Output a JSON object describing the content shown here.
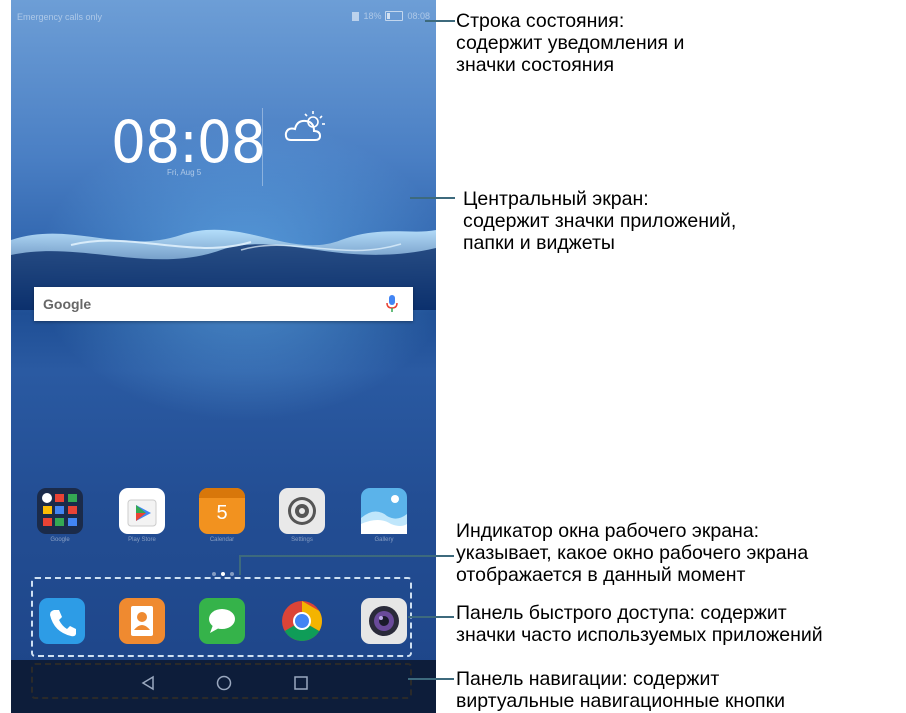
{
  "status_bar": {
    "carrier_text": "Emergency calls only",
    "battery_percent": "18%",
    "time": "08:08"
  },
  "clock_widget": {
    "time": "08:08",
    "date": "Fri, Aug 5",
    "weather_icon": "partly-cloudy-icon"
  },
  "search_bar": {
    "logo": "Google",
    "mic_icon": "microphone-icon"
  },
  "home_apps": [
    {
      "name": "Google",
      "icon": "folder-icon"
    },
    {
      "name": "Play Store",
      "icon": "play-store-icon"
    },
    {
      "name": "Calendar",
      "icon": "calendar-icon",
      "badge": "5"
    },
    {
      "name": "Settings",
      "icon": "gear-icon"
    },
    {
      "name": "Gallery",
      "icon": "gallery-icon"
    }
  ],
  "dock_apps": [
    {
      "name": "Phone",
      "icon": "phone-icon"
    },
    {
      "name": "Contacts",
      "icon": "contacts-icon"
    },
    {
      "name": "Messaging",
      "icon": "message-icon"
    },
    {
      "name": "Chrome",
      "icon": "chrome-icon"
    },
    {
      "name": "Camera",
      "icon": "camera-icon"
    }
  ],
  "page_indicator": {
    "pages": 3,
    "active": 1
  },
  "nav_bar": {
    "buttons": [
      "back-icon",
      "home-icon",
      "recents-icon"
    ]
  },
  "annotations": {
    "status_bar": [
      "Строка состояния:",
      "содержит уведомления и",
      "значки состояния"
    ],
    "main_screen": [
      "Центральный экран:",
      "содержит значки приложений,",
      "папки и виджеты"
    ],
    "page_indicator": [
      "Индикатор окна рабочего экрана:",
      "указывает, какое окно рабочего экрана",
      "отображается в данный момент"
    ],
    "dock": [
      "Панель быстрого доступа: содержит",
      "значки часто используемых приложений"
    ],
    "nav_bar": [
      "Панель навигации: содержит",
      "виртуальные навигационные кнопки"
    ]
  },
  "colors": {
    "callout_line": "#3d6a7d",
    "wallpaper": "#2f64ad"
  }
}
